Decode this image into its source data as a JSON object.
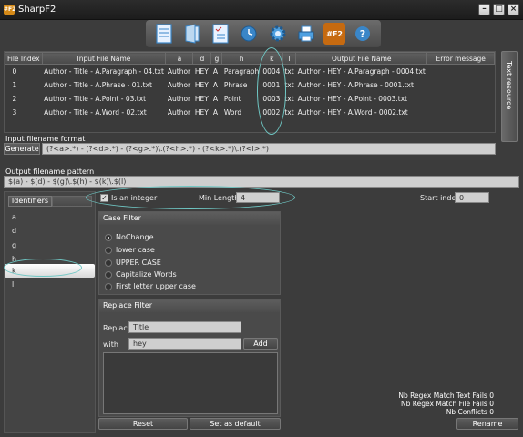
{
  "window": {
    "title": "SharpF2",
    "icon_label": "#F2"
  },
  "toolbar": {
    "buttons": [
      {
        "name": "document-icon"
      },
      {
        "name": "open-folder-icon"
      },
      {
        "name": "checklist-icon"
      },
      {
        "name": "clock-icon"
      },
      {
        "name": "gear-icon"
      },
      {
        "name": "printer-icon"
      },
      {
        "name": "f2-logo-icon",
        "label": "#F2"
      },
      {
        "name": "help-icon",
        "label": "?"
      }
    ]
  },
  "table": {
    "columns": [
      "File Index",
      "Input File Name",
      "a",
      "d",
      "g",
      "h",
      "k",
      "l",
      "Output File Name",
      "Error message"
    ],
    "rows": [
      [
        "0",
        "Author - Title - A.Paragraph - 04.txt",
        "Author",
        "HEY",
        "A",
        "Paragraph",
        "0004",
        "txt",
        "Author - HEY - A.Paragraph - 0004.txt",
        ""
      ],
      [
        "1",
        "Author - Title - A.Phrase - 01.txt",
        "Author",
        "HEY",
        "A",
        "Phrase",
        "0001",
        "txt",
        "Author - HEY - A.Phrase - 0001.txt",
        ""
      ],
      [
        "2",
        "Author - Title - A.Point - 03.txt",
        "Author",
        "HEY",
        "A",
        "Point",
        "0003",
        "txt",
        "Author - HEY - A.Point - 0003.txt",
        ""
      ],
      [
        "3",
        "Author - Title - A.Word - 02.txt",
        "Author",
        "HEY",
        "A",
        "Word",
        "0002",
        "txt",
        "Author - HEY - A.Word - 0002.txt",
        ""
      ]
    ]
  },
  "side_tab": {
    "label": "Text resource"
  },
  "input_format": {
    "label": "Input filename format",
    "generate_label": "Generate",
    "value": "(?<a>.*) - (?<d>.*) - (?<g>.*)\\.(?<h>.*) - (?<k>.*)\\.(?<l>.*)"
  },
  "output_pattern": {
    "label": "Output filename pattern",
    "value": "$(a) - $(d) - $(g)\\.$(h) - $(k)\\.$(l)"
  },
  "identifiers": {
    "header": "Identifiers",
    "items": [
      "a",
      "d",
      "g",
      "h",
      "k",
      "l"
    ],
    "selected": "k"
  },
  "integer": {
    "is_integer_label": "Is an integer",
    "checked": true,
    "min_length_label": "Min Length",
    "min_length_value": "4"
  },
  "start_index": {
    "label": "Start index",
    "value": "0"
  },
  "case_filter": {
    "title": "Case Filter",
    "options": [
      "NoChange",
      "lower case",
      "UPPER CASE",
      "Capitalize Words",
      "First letter upper case"
    ],
    "selected": "NoChange"
  },
  "replace_filter": {
    "title": "Replace Filter",
    "replace_label": "Replace",
    "replace_value": "Title",
    "with_label": "with",
    "with_value": "hey",
    "add_label": "Add"
  },
  "buttons": {
    "reset": "Reset",
    "set_default": "Set as default",
    "rename": "Rename"
  },
  "stats": [
    "Nb Regex Match Text Fails 0",
    "Nb Regex Match File Fails 0",
    "Nb Conflicts 0"
  ],
  "colors": {
    "highlight_ellipse": "#6fc7c4",
    "background": "#3c3c3c"
  }
}
